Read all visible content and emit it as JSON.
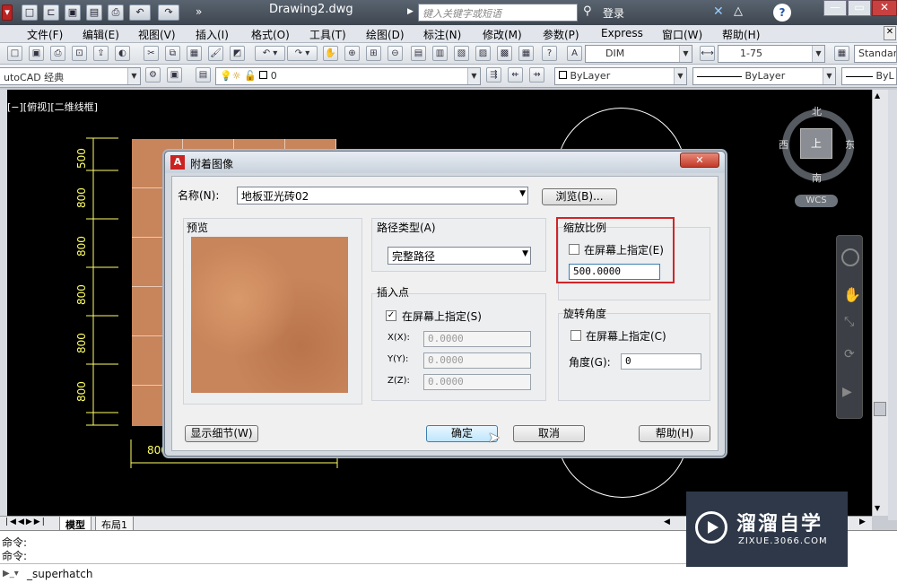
{
  "window": {
    "title": "Drawing2.dwg",
    "search_placeholder": "键入关键字或短语",
    "login": "登录",
    "help": "?"
  },
  "menu": [
    "文件(F)",
    "编辑(E)",
    "视图(V)",
    "插入(I)",
    "格式(O)",
    "工具(T)",
    "绘图(D)",
    "标注(N)",
    "修改(M)",
    "参数(P)",
    "Express",
    "窗口(W)",
    "帮助(H)"
  ],
  "toolbar": {
    "dimstyle": "DIM",
    "scale": "1-75",
    "textstyle": "Standar",
    "workspace": "utoCAD 经典",
    "layer": "0",
    "color": "ByLayer",
    "linetype": "ByLayer",
    "lineweight": "ByL"
  },
  "viewport": {
    "label": "[−][俯视][二维线框]"
  },
  "dims": [
    "500",
    "800",
    "800",
    "800",
    "800",
    "800",
    "800"
  ],
  "dim_bottom": "800",
  "viewcube": {
    "north": "北",
    "south": "南",
    "east": "东",
    "west": "西",
    "face": "上",
    "wcs": "WCS"
  },
  "tabs": [
    "模型",
    "布局1"
  ],
  "command": {
    "line1": "命令:",
    "line2": "命令:",
    "input": "_superhatch"
  },
  "watermark": {
    "brand": "溜溜自学",
    "site": "ZIXUE.3066.COM"
  },
  "dialog": {
    "title": "附着图像",
    "name_label": "名称(N):",
    "name_value": "地板亚光砖02",
    "browse": "浏览(B)...",
    "preview_label": "预览",
    "path_type_label": "路径类型(A)",
    "path_type_value": "完整路径",
    "insert_label": "插入点",
    "insert_onscreen": "在屏幕上指定(S)",
    "x_label": "X(X):",
    "x_value": "0.0000",
    "y_label": "Y(Y):",
    "y_value": "0.0000",
    "z_label": "Z(Z):",
    "z_value": "0.0000",
    "scale_label": "缩放比例",
    "scale_onscreen": "在屏幕上指定(E)",
    "scale_value": "500.0000",
    "rotation_label": "旋转角度",
    "rotation_onscreen": "在屏幕上指定(C)",
    "angle_label": "角度(G):",
    "angle_value": "0",
    "details": "显示细节(W)",
    "ok": "确定",
    "cancel": "取消",
    "help": "帮助(H)"
  }
}
